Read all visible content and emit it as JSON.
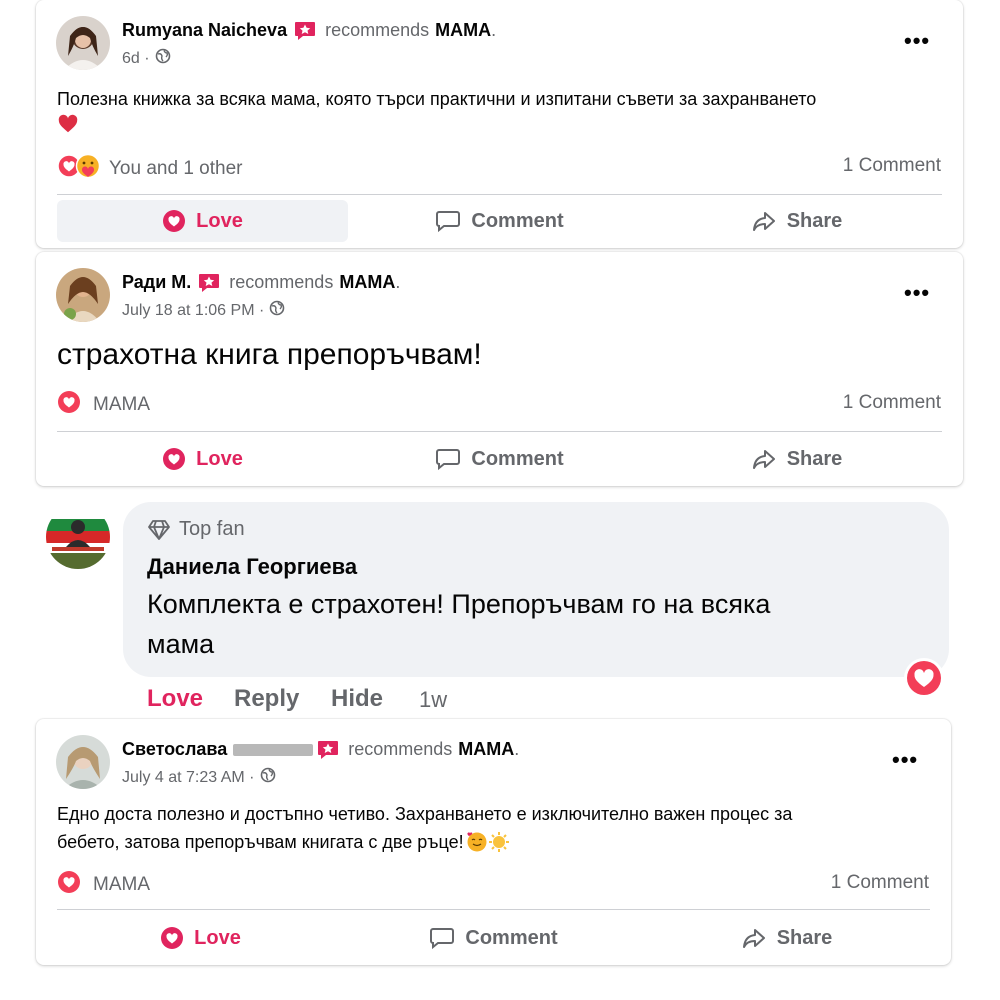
{
  "colors": {
    "love": "#e0245e",
    "secondary_text": "#65676b",
    "divider": "#ced0d4",
    "bubble": "#f0f2f5"
  },
  "posts": [
    {
      "author": "Rumyana Naicheva",
      "recommends": "recommends",
      "page": "MAMA",
      "punct": ".",
      "time": "6d ·",
      "text": "Полезна книжка за всяка мама, която търси практични и изпитани съвети за захранването",
      "emoji": "❤️",
      "reactions_label": "You and 1 other",
      "comments_count": "1 Comment",
      "actions": {
        "love": "Love",
        "comment": "Comment",
        "share": "Share"
      }
    },
    {
      "author": "Ради М.",
      "recommends": "recommends",
      "page": "MAMA",
      "punct": ".",
      "time": "July 18 at 1:06 PM ·",
      "text": "страхотна книга препоръчвам!",
      "reactions_label": "MAMA",
      "comments_count": "1 Comment",
      "actions": {
        "love": "Love",
        "comment": "Comment",
        "share": "Share"
      }
    },
    {
      "author": "Светослава",
      "recommends": "recommends",
      "page": "MAMA",
      "punct": ".",
      "time": "July 4 at 7:23 AM ·",
      "text_line1": "Едно доста полезно и достъпно четиво. Захранването е изключително важен процес за",
      "text_line2": "бебето, затова препоръчвам книгата с две ръце!",
      "emoji": "🥰🌞",
      "reactions_label": "MAMA",
      "comments_count": "1 Comment",
      "actions": {
        "love": "Love",
        "comment": "Comment",
        "share": "Share"
      }
    }
  ],
  "comment": {
    "badge": "Top fan",
    "author": "Даниела Георгиева",
    "text_line1": "Комплекта е страхотен! Препоръчвам го на всяка",
    "text_line2": "мама",
    "actions": {
      "love": "Love",
      "reply": "Reply",
      "hide": "Hide"
    },
    "time": "1w"
  },
  "icons": {
    "more": "more-horizontal-icon",
    "globe": "globe-icon",
    "love": "heart-icon",
    "comment": "speech-bubble-icon",
    "share": "share-arrow-icon",
    "diamond": "diamond-icon"
  }
}
